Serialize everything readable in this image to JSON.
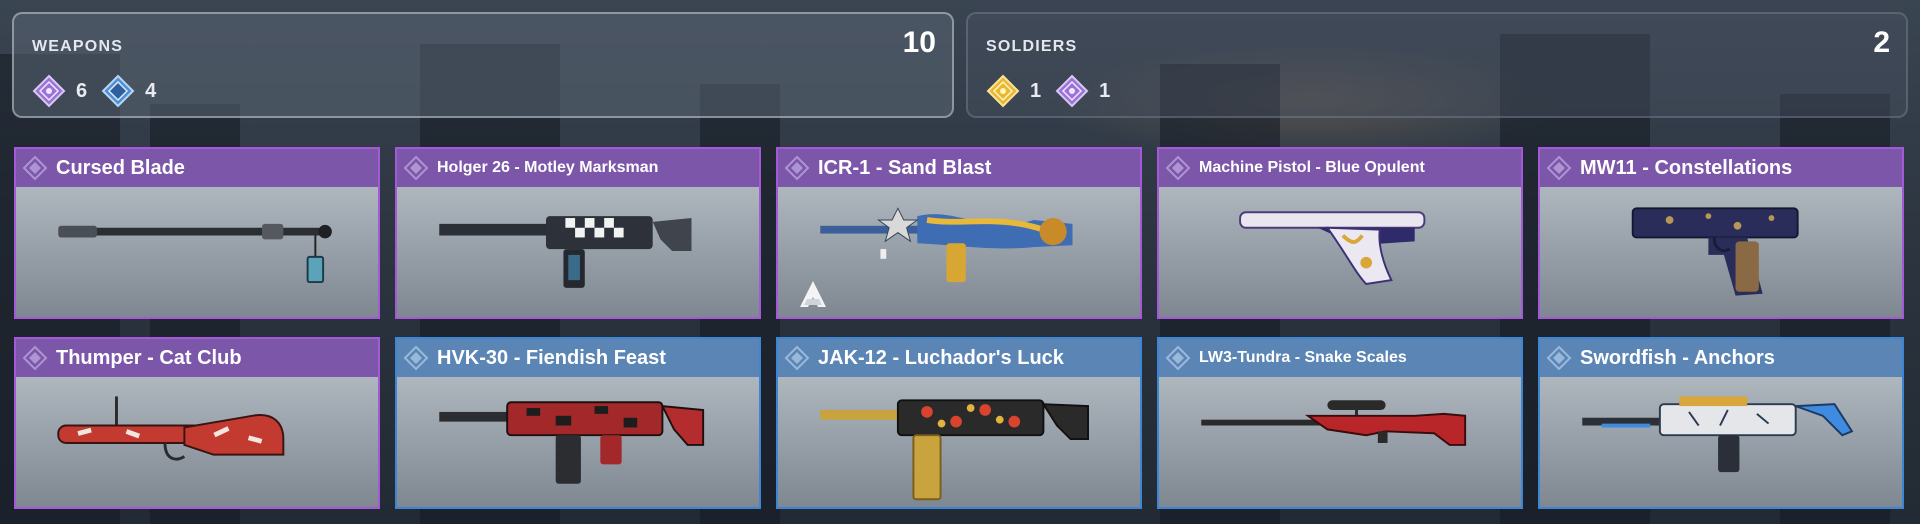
{
  "summary": {
    "weapons": {
      "label": "WEAPONS",
      "total": "10",
      "counts": [
        {
          "icon": "epic-rarity-gem-icon",
          "color": "#9b72d6",
          "value": "6"
        },
        {
          "icon": "rare-rarity-gem-icon",
          "color": "#4f8fd6",
          "value": "4"
        }
      ]
    },
    "soldiers": {
      "label": "SOLDIERS",
      "total": "2",
      "counts": [
        {
          "icon": "legendary-rarity-gem-icon",
          "color": "#e8b830",
          "value": "1"
        },
        {
          "icon": "epic-rarity-gem-icon",
          "color": "#9b72d6",
          "value": "1"
        }
      ]
    }
  },
  "rarity_colors": {
    "epic_header": "#7b56a9",
    "epic_border": "#a45ad8",
    "rare_header": "#5a85b5",
    "rare_border": "#3d86d6"
  },
  "weapons": [
    {
      "name": "Cursed Blade",
      "rarity": "epic",
      "art": "melee-blade-icon"
    },
    {
      "name": "Holger 26 - Motley Marksman",
      "rarity": "epic",
      "art": "lmg-icon"
    },
    {
      "name": "ICR-1 - Sand Blast",
      "rarity": "epic",
      "art": "assault-rifle-icon"
    },
    {
      "name": "Machine Pistol - Blue Opulent",
      "rarity": "epic",
      "art": "machine-pistol-icon"
    },
    {
      "name": "MW11 - Constellations",
      "rarity": "epic",
      "art": "pistol-icon"
    },
    {
      "name": "Thumper - Cat Club",
      "rarity": "epic",
      "art": "launcher-icon"
    },
    {
      "name": "HVK-30 - Fiendish Feast",
      "rarity": "rare",
      "art": "smg-icon"
    },
    {
      "name": "JAK-12 - Luchador's Luck",
      "rarity": "rare",
      "art": "shotgun-icon"
    },
    {
      "name": "LW3-Tundra - Snake Scales",
      "rarity": "rare",
      "art": "sniper-rifle-icon"
    },
    {
      "name": "Swordfish - Anchors",
      "rarity": "rare",
      "art": "burst-rifle-icon"
    }
  ]
}
